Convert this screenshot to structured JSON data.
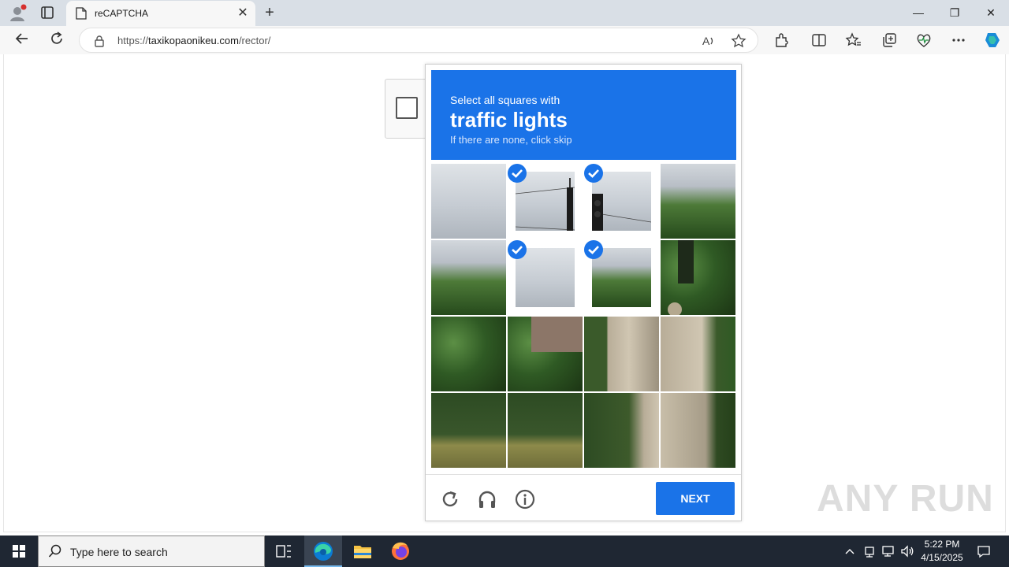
{
  "browser": {
    "tab_title": "reCAPTCHA",
    "tab_close": "✕",
    "new_tab": "+",
    "url_scheme": "https://",
    "url_host": "taxikopaonikeu.com",
    "url_path": "/rector/",
    "window_controls": {
      "minimize": "—",
      "maximize": "❐",
      "close": "✕"
    },
    "icons": [
      "profile-icon",
      "tab-actions-icon",
      "page-icon",
      "back-icon",
      "refresh-icon",
      "lock-icon",
      "read-aloud-icon",
      "favorite-star-icon",
      "extensions-icon",
      "split-screen-icon",
      "favorites-icon",
      "collections-icon",
      "performance-icon",
      "more-icon",
      "copilot-icon"
    ]
  },
  "captcha": {
    "instruction_prefix": "Select all squares with",
    "object": "traffic lights",
    "subtext": "If there are none, click skip",
    "next_label": "NEXT",
    "selected_tiles": [
      1,
      2,
      5,
      6
    ],
    "footer_icons": [
      "reload-icon",
      "audio-headphones-icon",
      "info-icon"
    ],
    "accent_color": "#1a73e8"
  },
  "watermark": "ANY RUN",
  "taskbar": {
    "search_placeholder": "Type here to search",
    "time": "5:22 PM",
    "date": "4/15/2025",
    "apps": [
      "task-view-icon",
      "edge-icon",
      "file-explorer-icon",
      "firefox-icon"
    ],
    "tray_icons": [
      "chevron-up-icon",
      "network-icon",
      "display-icon",
      "volume-icon",
      "notification-icon"
    ]
  }
}
